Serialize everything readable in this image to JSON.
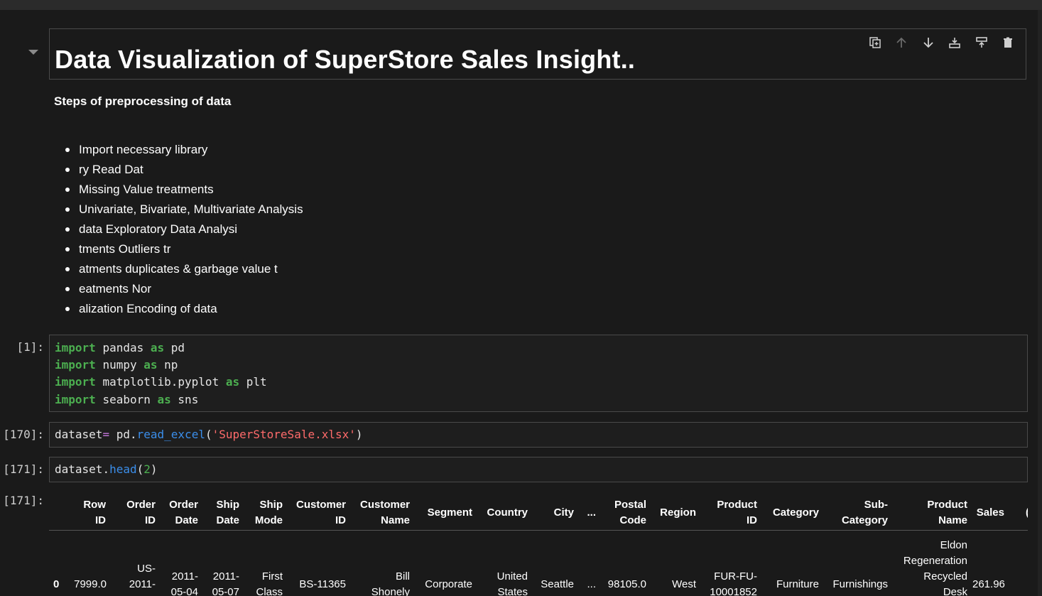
{
  "markdown_heading": {
    "title": "Data Visualization of SuperStore Sales Insight..",
    "toolbar": [
      "duplicate-icon",
      "move-up-icon",
      "move-down-icon",
      "insert-above-icon",
      "insert-below-icon",
      "delete-icon"
    ]
  },
  "markdown_body": {
    "subtitle": "Steps of preprocessing of data",
    "items": [
      "Import necessary library",
      "ry Read Dat",
      "Missing Value treatments",
      "Univariate, Bivariate, Multivariate Analysis",
      "data Exploratory Data Analysi",
      "tments Outliers tr",
      "atments duplicates & garbage value t",
      "eatments Nor",
      "alization Encoding of data"
    ]
  },
  "cells": {
    "c1": {
      "prompt": "[1]:",
      "lines": [
        [
          "import",
          "pandas",
          "as",
          "pd"
        ],
        [
          "import",
          "numpy",
          "as",
          "np"
        ],
        [
          "import",
          "matplotlib.pyplot",
          "as",
          "plt"
        ],
        [
          "import",
          "seaborn",
          "as",
          "sns"
        ]
      ]
    },
    "c2": {
      "prompt": "[170]:",
      "var": "dataset",
      "eq": "=",
      "obj": " pd",
      "dot": ".",
      "method": "read_excel",
      "open": "(",
      "arg": "'SuperStoreSale.xlsx'",
      "close": ")"
    },
    "c3": {
      "prompt": "[171]:",
      "var": "dataset",
      "dot": ".",
      "method": "head",
      "open": "(",
      "arg": "2",
      "close": ")"
    },
    "out": {
      "prompt": "[171]:"
    }
  },
  "table": {
    "headers": [
      [
        "Row",
        "ID"
      ],
      [
        "Order",
        "ID"
      ],
      [
        "Order",
        "Date"
      ],
      [
        "Ship",
        "Date"
      ],
      [
        "Ship",
        "Mode"
      ],
      [
        "Customer",
        "ID"
      ],
      [
        "Customer",
        "Name"
      ],
      [
        "Segment"
      ],
      [
        "Country"
      ],
      [
        "City"
      ],
      [
        "..."
      ],
      [
        "Postal",
        "Code"
      ],
      [
        "Region"
      ],
      [
        "Product",
        "ID"
      ],
      [
        "Category"
      ],
      [
        "Sub-",
        "Category"
      ],
      [
        "Product",
        "Name"
      ],
      [
        "Sales"
      ],
      [
        "("
      ]
    ],
    "row0": {
      "index": "0",
      "row_id": "7999.0",
      "order_id": [
        "US-",
        "2011-"
      ],
      "order_date": [
        "2011-",
        "05-04"
      ],
      "ship_date": [
        "2011-",
        "05-07"
      ],
      "ship_mode": [
        "First",
        "Class"
      ],
      "customer_id": "BS-11365",
      "customer_name": [
        "Bill",
        "Shonely"
      ],
      "segment": "Corporate",
      "country": [
        "United",
        "States"
      ],
      "city": "Seattle",
      "ellipsis": "...",
      "postal_code": "98105.0",
      "region": "West",
      "product_id": [
        "FUR-FU-",
        "10001852"
      ],
      "category": "Furniture",
      "sub_category": "Furnishings",
      "product_name": [
        "Eldon",
        "Regeneration",
        "Recycled",
        "Desk"
      ],
      "sales": "261.96"
    }
  }
}
